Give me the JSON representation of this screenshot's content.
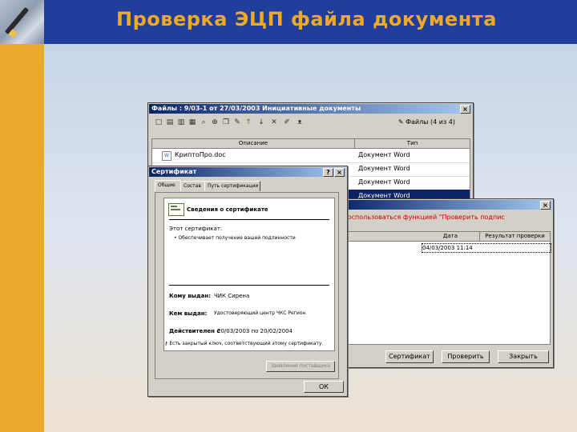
{
  "slide": {
    "title": "Проверка ЭЦП файла документа"
  },
  "files_window": {
    "title": "Файлы : 9/03-1 от 27/03/2003 Инициативные документы",
    "count_label": "Файлы (4 из 4)",
    "columns": [
      "Описание",
      "Тип"
    ],
    "rows": [
      {
        "name": "КриптоПро.doc",
        "type": "Документ Word",
        "selected": false
      },
      {
        "name": "",
        "type": "Документ Word",
        "selected": false
      },
      {
        "name": "",
        "type": "Документ Word",
        "selected": false
      },
      {
        "name": "",
        "type": "Документ Word",
        "selected": true
      }
    ]
  },
  "check_window": {
    "message": "воспользоваться функцией \"Проверить подпис",
    "columns": [
      "Дата",
      "Результат проверки"
    ],
    "row_date": "04/03/2003 11:14",
    "buttons": [
      "Сертификат",
      "Проверить",
      "Закрыть"
    ]
  },
  "cert_window": {
    "title": "Сертификат",
    "tabs": [
      "Общие",
      "Состав",
      "Путь сертификации"
    ],
    "header": "Сведения о сертификате",
    "purpose_label": "Этот сертификат:",
    "purpose_value": "• Обеспечивает получение вашей подлинности",
    "issued_to_label": "Кому выдан:",
    "issued_to_value": "ЧИК Сирена",
    "issued_by_label": "Кем выдан:",
    "issued_by_value": "Удостоверяющий центр ЧКС Регион",
    "valid_label": "Действителен с",
    "valid_value": "20/03/2003 по 20/02/2004",
    "key_note": "Есть закрытый ключ, соответствующий этому сертификату.",
    "issuer_stmt_button": "Заявление поставщика",
    "ok_button": "ОК"
  }
}
